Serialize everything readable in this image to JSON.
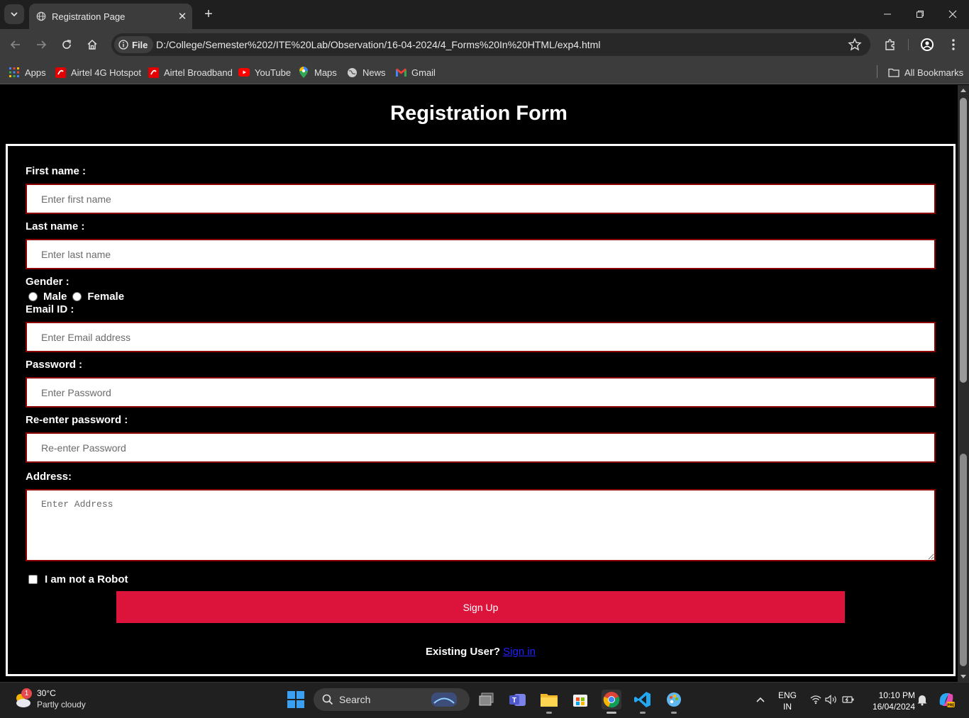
{
  "browser": {
    "tab_title": "Registration Page",
    "url_chip": "File",
    "url": "D:/College/Semester%202/ITE%20Lab/Observation/16-04-2024/4_Forms%20In%20HTML/exp4.html",
    "bookmarks": [
      {
        "label": "Apps",
        "icon": "apps-grid-icon"
      },
      {
        "label": "Airtel 4G Hotspot",
        "icon": "airtel-icon"
      },
      {
        "label": "Airtel Broadband",
        "icon": "airtel-icon"
      },
      {
        "label": "YouTube",
        "icon": "youtube-icon"
      },
      {
        "label": "Maps",
        "icon": "maps-icon"
      },
      {
        "label": "News",
        "icon": "news-icon"
      },
      {
        "label": "Gmail",
        "icon": "gmail-icon"
      }
    ],
    "all_bookmarks": "All Bookmarks"
  },
  "form": {
    "title": "Registration Form",
    "first_name_label": "First name :",
    "first_name_placeholder": "Enter first name",
    "last_name_label": "Last name :",
    "last_name_placeholder": "Enter last name",
    "gender_label": "Gender :",
    "gender_male": "Male",
    "gender_female": "Female",
    "email_label": "Email ID :",
    "email_placeholder": "Enter Email address",
    "password_label": "Password :",
    "password_placeholder": "Enter Password",
    "reenter_label": "Re-enter password :",
    "reenter_placeholder": "Re-enter Password",
    "address_label": "Address:",
    "address_placeholder": "Enter Address",
    "robot_label": "I am not a Robot",
    "signup_label": "Sign Up",
    "existing_text": "Existing User?",
    "signin_link": "Sign in"
  },
  "taskbar": {
    "weather_temp": "30°C",
    "weather_desc": "Partly cloudy",
    "weather_badge": "1",
    "search_label": "Search",
    "lang_top": "ENG",
    "lang_bottom": "IN",
    "time": "10:10 PM",
    "date": "16/04/2024"
  },
  "colors": {
    "accent": "#dc143c",
    "input_border": "#8b0000",
    "background": "#000000"
  }
}
